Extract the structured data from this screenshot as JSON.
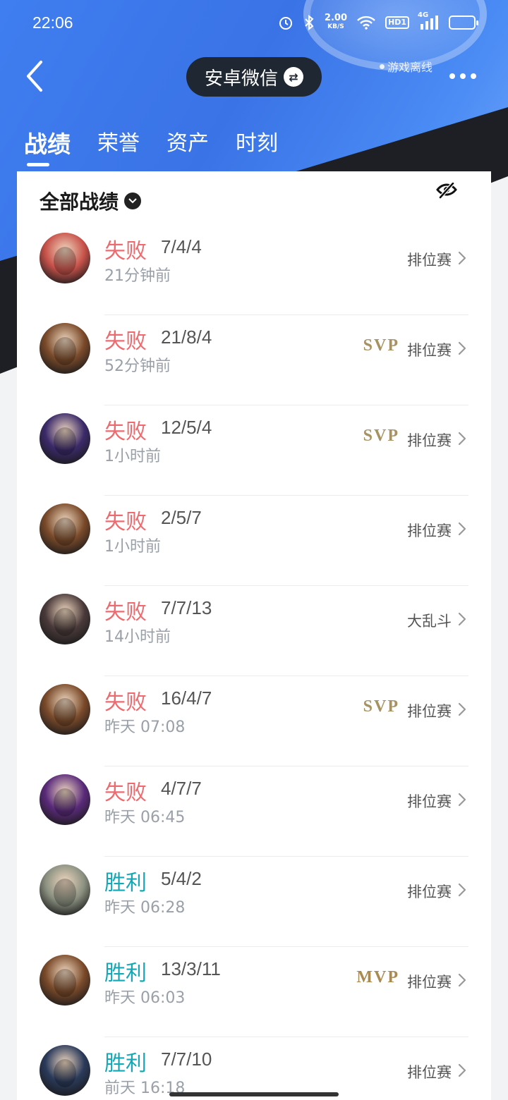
{
  "status_bar": {
    "time": "22:06",
    "net_speed_value": "2.00",
    "net_speed_unit": "KB/S",
    "hd_label": "HD1",
    "signal_label": "4G"
  },
  "nav": {
    "account_label": "安卓微信",
    "offline_label": "游戏离线"
  },
  "tabs": [
    {
      "label": "战绩",
      "active": true
    },
    {
      "label": "荣誉",
      "active": false
    },
    {
      "label": "资产",
      "active": false
    },
    {
      "label": "时刻",
      "active": false
    }
  ],
  "card": {
    "title": "全部战绩"
  },
  "colors": {
    "lose": "#ee6a6f",
    "win": "#13a8b6",
    "svp": "#a79264",
    "mvp": "#a98a52"
  },
  "matches": [
    {
      "result": "失败",
      "outcome": "lose",
      "kda": "7/4/4",
      "time": "21分钟前",
      "badge": "",
      "mode": "排位赛",
      "hero_color": "#c8524a"
    },
    {
      "result": "失败",
      "outcome": "lose",
      "kda": "21/8/4",
      "time": "52分钟前",
      "badge": "SVP",
      "mode": "排位赛",
      "hero_color": "#7a4a2a"
    },
    {
      "result": "失败",
      "outcome": "lose",
      "kda": "12/5/4",
      "time": "1小时前",
      "badge": "SVP",
      "mode": "排位赛",
      "hero_color": "#3b2a6a"
    },
    {
      "result": "失败",
      "outcome": "lose",
      "kda": "2/5/7",
      "time": "1小时前",
      "badge": "",
      "mode": "排位赛",
      "hero_color": "#7a4a2a"
    },
    {
      "result": "失败",
      "outcome": "lose",
      "kda": "7/7/13",
      "time": "14小时前",
      "badge": "",
      "mode": "大乱斗",
      "hero_color": "#4a3a3a"
    },
    {
      "result": "失败",
      "outcome": "lose",
      "kda": "16/4/7",
      "time": "昨天 07:08",
      "badge": "SVP",
      "mode": "排位赛",
      "hero_color": "#7a4a2a"
    },
    {
      "result": "失败",
      "outcome": "lose",
      "kda": "4/7/7",
      "time": "昨天 06:45",
      "badge": "",
      "mode": "排位赛",
      "hero_color": "#5a2a7a"
    },
    {
      "result": "胜利",
      "outcome": "win",
      "kda": "5/4/2",
      "time": "昨天 06:28",
      "badge": "",
      "mode": "排位赛",
      "hero_color": "#8a9080"
    },
    {
      "result": "胜利",
      "outcome": "win",
      "kda": "13/3/11",
      "time": "昨天 06:03",
      "badge": "MVP",
      "mode": "排位赛",
      "hero_color": "#7a4a2a"
    },
    {
      "result": "胜利",
      "outcome": "win",
      "kda": "7/7/10",
      "time": "前天 16:18",
      "badge": "",
      "mode": "排位赛",
      "hero_color": "#2a3a5a"
    }
  ]
}
